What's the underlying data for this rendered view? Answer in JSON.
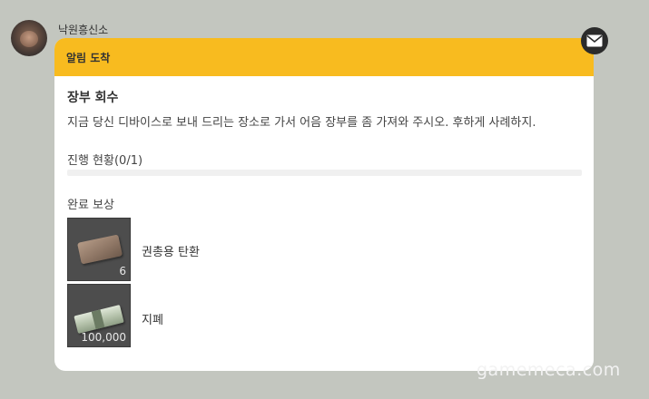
{
  "sender": {
    "name": "낙원흥신소"
  },
  "card": {
    "header_title": "알림 도착",
    "quest_title": "장부 회수",
    "quest_description": "지금 당신 디바이스로 보내 드리는 장소로 가서 어음 장부를 좀 가져와 주시오. 후하게 사례하지.",
    "progress_label": "진행 현황(0/1)",
    "progress_fraction": 0.0,
    "reward_label": "완료 보상",
    "rewards": [
      {
        "name": "권총용 탄환",
        "count": "6",
        "icon": "pistol-ammo-icon"
      },
      {
        "name": "지폐",
        "count": "100,000",
        "icon": "cash-bundle-icon"
      }
    ]
  },
  "icons": {
    "mail": "envelope-icon",
    "cursor": "pointer-cursor-icon"
  },
  "colors": {
    "accent": "#f8bb1f",
    "background": "#c3c6bf",
    "card": "#ffffff"
  },
  "watermark": "gamemeca.com"
}
